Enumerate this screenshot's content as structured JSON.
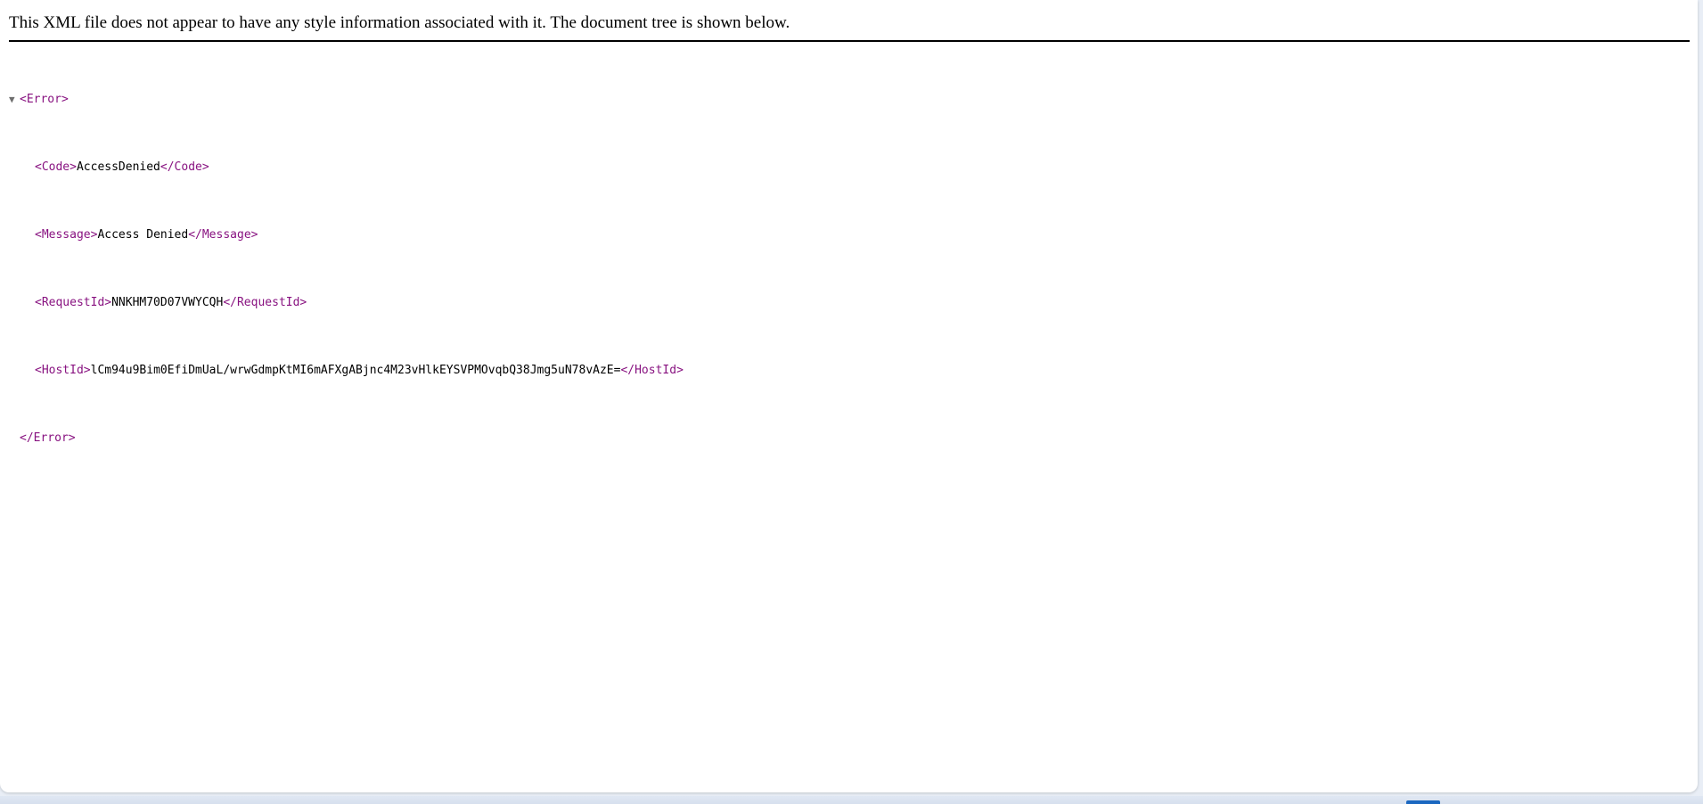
{
  "info_banner": "This XML file does not appear to have any style information associated with it. The document tree is shown below.",
  "tree": {
    "toggle_glyph": "▼",
    "root_open": "<Error>",
    "root_close": "</Error>",
    "children": [
      {
        "open": "<Code>",
        "value": "AccessDenied",
        "close": "</Code>"
      },
      {
        "open": "<Message>",
        "value": "Access Denied",
        "close": "</Message>"
      },
      {
        "open": "<RequestId>",
        "value": "NNKHM70D07VWYCQH",
        "close": "</RequestId>"
      },
      {
        "open": "<HostId>",
        "value": "lCm94u9Bim0EfiDmUaL/wrwGdmpKtMI6mAFXgABjnc4M23vHlkEYSVPMOvqbQ38Jmg5uN78vAzE=",
        "close": "</HostId>"
      }
    ]
  },
  "colors": {
    "tag": "#881280",
    "text": "#000000",
    "toggle": "#6e6e6e"
  }
}
